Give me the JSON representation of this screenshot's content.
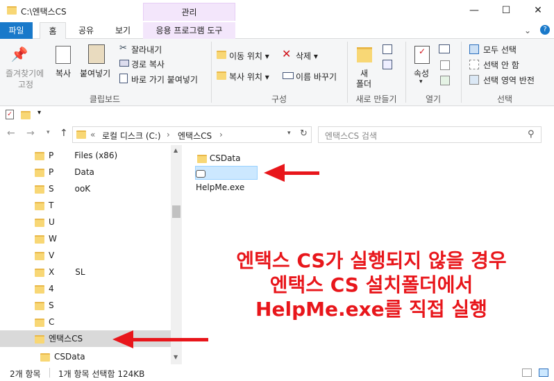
{
  "window": {
    "title": "C:\\엔택스CS",
    "context_header": "관리",
    "min_icon": "minimize-icon",
    "max_icon": "maximize-icon",
    "close_icon": "close-icon"
  },
  "ribbon_tabs": {
    "file": "파일",
    "home": "홈",
    "share": "공유",
    "view": "보기",
    "app_tools": "응용 프로그램 도구"
  },
  "ribbon": {
    "clipboard": {
      "pin": "즐겨찾기에",
      "pin2": "고정",
      "copy": "복사",
      "paste": "붙여넣기",
      "cut": "잘라내기",
      "copy_path": "경로 복사",
      "paste_shortcut": "바로 가기 붙여넣기",
      "label": "클립보드"
    },
    "organize": {
      "move_to": "이동 위치 ▾",
      "copy_to": "복사 위치 ▾",
      "delete": "삭제 ▾",
      "rename": "이름 바꾸기",
      "label": "구성"
    },
    "new": {
      "new_folder_1": "새",
      "new_folder_2": "폴더",
      "label": "새로 만들기"
    },
    "open": {
      "properties": "속성",
      "label": "열기"
    },
    "select": {
      "select_all": "모두 선택",
      "select_none": "선택 안 함",
      "invert": "선택 영역 반전",
      "label": "선택"
    }
  },
  "address": {
    "prefix": "«",
    "crumb1": "로컬 디스크 (C:)",
    "crumb2": "엔택스CS",
    "search_placeholder": "엔택스CS 검색"
  },
  "nav_tree": [
    {
      "label": "Files (x86)",
      "prefix": "P"
    },
    {
      "label": "Data",
      "prefix": "P"
    },
    {
      "label": "ooK",
      "prefix": "S"
    },
    {
      "label": "",
      "prefix": "T"
    },
    {
      "label": "",
      "prefix": "U"
    },
    {
      "label": "",
      "prefix": "W"
    },
    {
      "label": "",
      "prefix": "V"
    },
    {
      "label": "SL",
      "prefix": "X"
    },
    {
      "label": "",
      "prefix": "4"
    },
    {
      "label": "",
      "prefix": "S"
    },
    {
      "label": "",
      "prefix": "C"
    },
    {
      "label": "엔택스CS",
      "prefix": ""
    },
    {
      "label": "CSData",
      "prefix": ""
    }
  ],
  "files": [
    {
      "name": "CSData",
      "type": "folder"
    },
    {
      "name": "HelpMe.exe",
      "type": "exe"
    }
  ],
  "status": {
    "count": "2개 항목",
    "selected": "1개 항목 선택함 124KB"
  },
  "annotation": {
    "line1": "엔택스 CS가 실행되지 않을 경우",
    "line2": "엔택스 CS 설치폴더에서",
    "line3": "HelpMe.exe를 직접 실행",
    "color": "#e8161b"
  }
}
